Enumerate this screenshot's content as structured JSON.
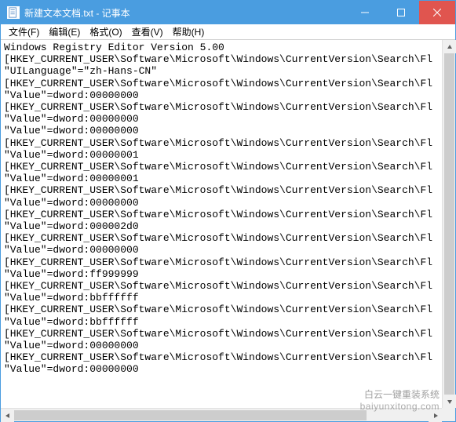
{
  "window": {
    "title": "新建文本文档.txt - 记事本",
    "app_icon": "notepad-icon"
  },
  "menu": {
    "file": "文件(F)",
    "edit": "编辑(E)",
    "format": "格式(O)",
    "view": "查看(V)",
    "help": "帮助(H)"
  },
  "content_lines": [
    "Windows Registry Editor Version 5.00",
    "[HKEY_CURRENT_USER\\Software\\Microsoft\\Windows\\CurrentVersion\\Search\\Fl",
    "\"UILanguage\"=\"zh-Hans-CN\"",
    "[HKEY_CURRENT_USER\\Software\\Microsoft\\Windows\\CurrentVersion\\Search\\Fl",
    "\"Value\"=dword:00000000",
    "[HKEY_CURRENT_USER\\Software\\Microsoft\\Windows\\CurrentVersion\\Search\\Fl",
    "\"Value\"=dword:00000000",
    "\"Value\"=dword:00000000",
    "[HKEY_CURRENT_USER\\Software\\Microsoft\\Windows\\CurrentVersion\\Search\\Fl",
    "\"Value\"=dword:00000001",
    "[HKEY_CURRENT_USER\\Software\\Microsoft\\Windows\\CurrentVersion\\Search\\Fl",
    "\"Value\"=dword:00000001",
    "[HKEY_CURRENT_USER\\Software\\Microsoft\\Windows\\CurrentVersion\\Search\\Fl",
    "\"Value\"=dword:00000000",
    "[HKEY_CURRENT_USER\\Software\\Microsoft\\Windows\\CurrentVersion\\Search\\Fl",
    "\"Value\"=dword:000002d0",
    "[HKEY_CURRENT_USER\\Software\\Microsoft\\Windows\\CurrentVersion\\Search\\Fl",
    "\"Value\"=dword:00000000",
    "[HKEY_CURRENT_USER\\Software\\Microsoft\\Windows\\CurrentVersion\\Search\\Fl",
    "\"Value\"=dword:ff999999",
    "[HKEY_CURRENT_USER\\Software\\Microsoft\\Windows\\CurrentVersion\\Search\\Fl",
    "\"Value\"=dword:bbffffff",
    "[HKEY_CURRENT_USER\\Software\\Microsoft\\Windows\\CurrentVersion\\Search\\Fl",
    "\"Value\"=dword:bbffffff",
    "[HKEY_CURRENT_USER\\Software\\Microsoft\\Windows\\CurrentVersion\\Search\\Fl",
    "\"Value\"=dword:00000000",
    "[HKEY_CURRENT_USER\\Software\\Microsoft\\Windows\\CurrentVersion\\Search\\Fl",
    "\"Value\"=dword:00000000"
  ],
  "watermark": {
    "line1": "白云一键重装系统",
    "line2": "baiyunxitong.com"
  }
}
